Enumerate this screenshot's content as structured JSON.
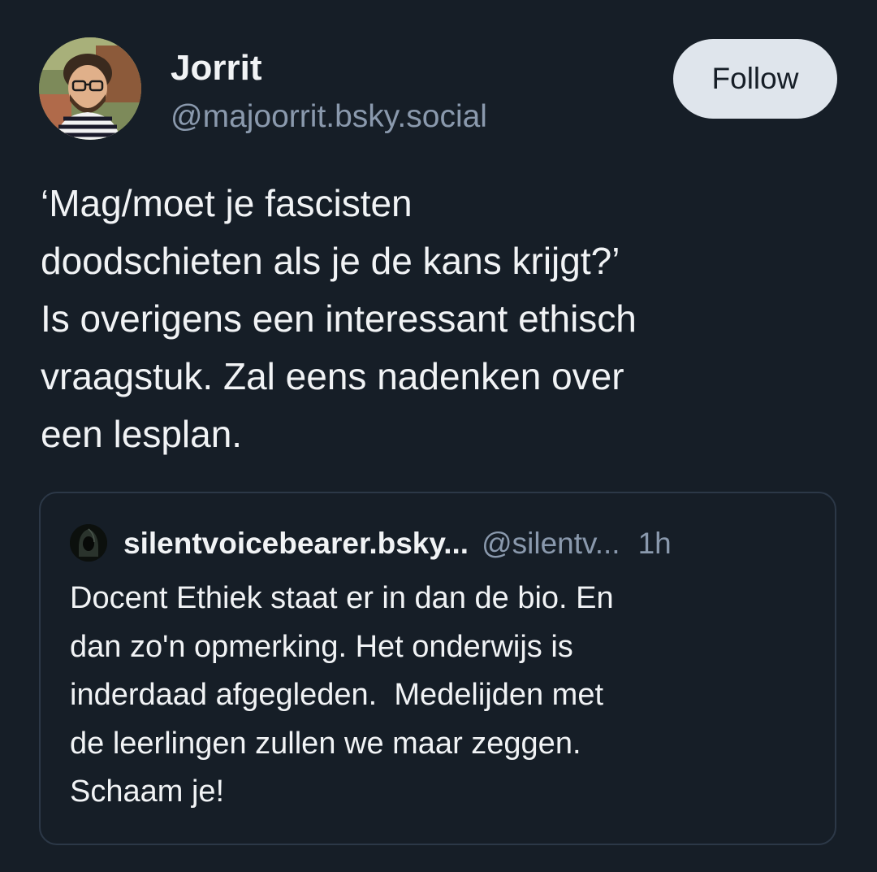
{
  "post": {
    "author": {
      "name": "Jorrit",
      "handle": "@majoorrit.bsky.social",
      "avatar_icon": "profile-photo"
    },
    "follow_label": "Follow",
    "text_lines": [
      "‘Mag/moet je fascisten",
      "doodschieten als je de kans krijgt?’",
      "Is overigens een interessant ethisch",
      "vraagstuk. Zal eens nadenken over",
      "een lesplan."
    ],
    "quoted": {
      "name": "silentvoicebearer.bsky...",
      "handle": "@silentv...",
      "time": "1h",
      "avatar_icon": "hooded-figure-icon",
      "text_lines": [
        "Docent Ethiek staat er in dan de bio. En",
        "dan zo'n opmerking. Het onderwijs is",
        "inderdaad afgegleden.  Medelijden met",
        "de leerlingen zullen we maar zeggen.",
        "Schaam je!"
      ]
    }
  },
  "colors": {
    "background": "#161e27",
    "text": "#f1f3f5",
    "muted": "#8a99ad",
    "follow_bg": "#dfe5ec",
    "card_border": "#2c3847"
  }
}
